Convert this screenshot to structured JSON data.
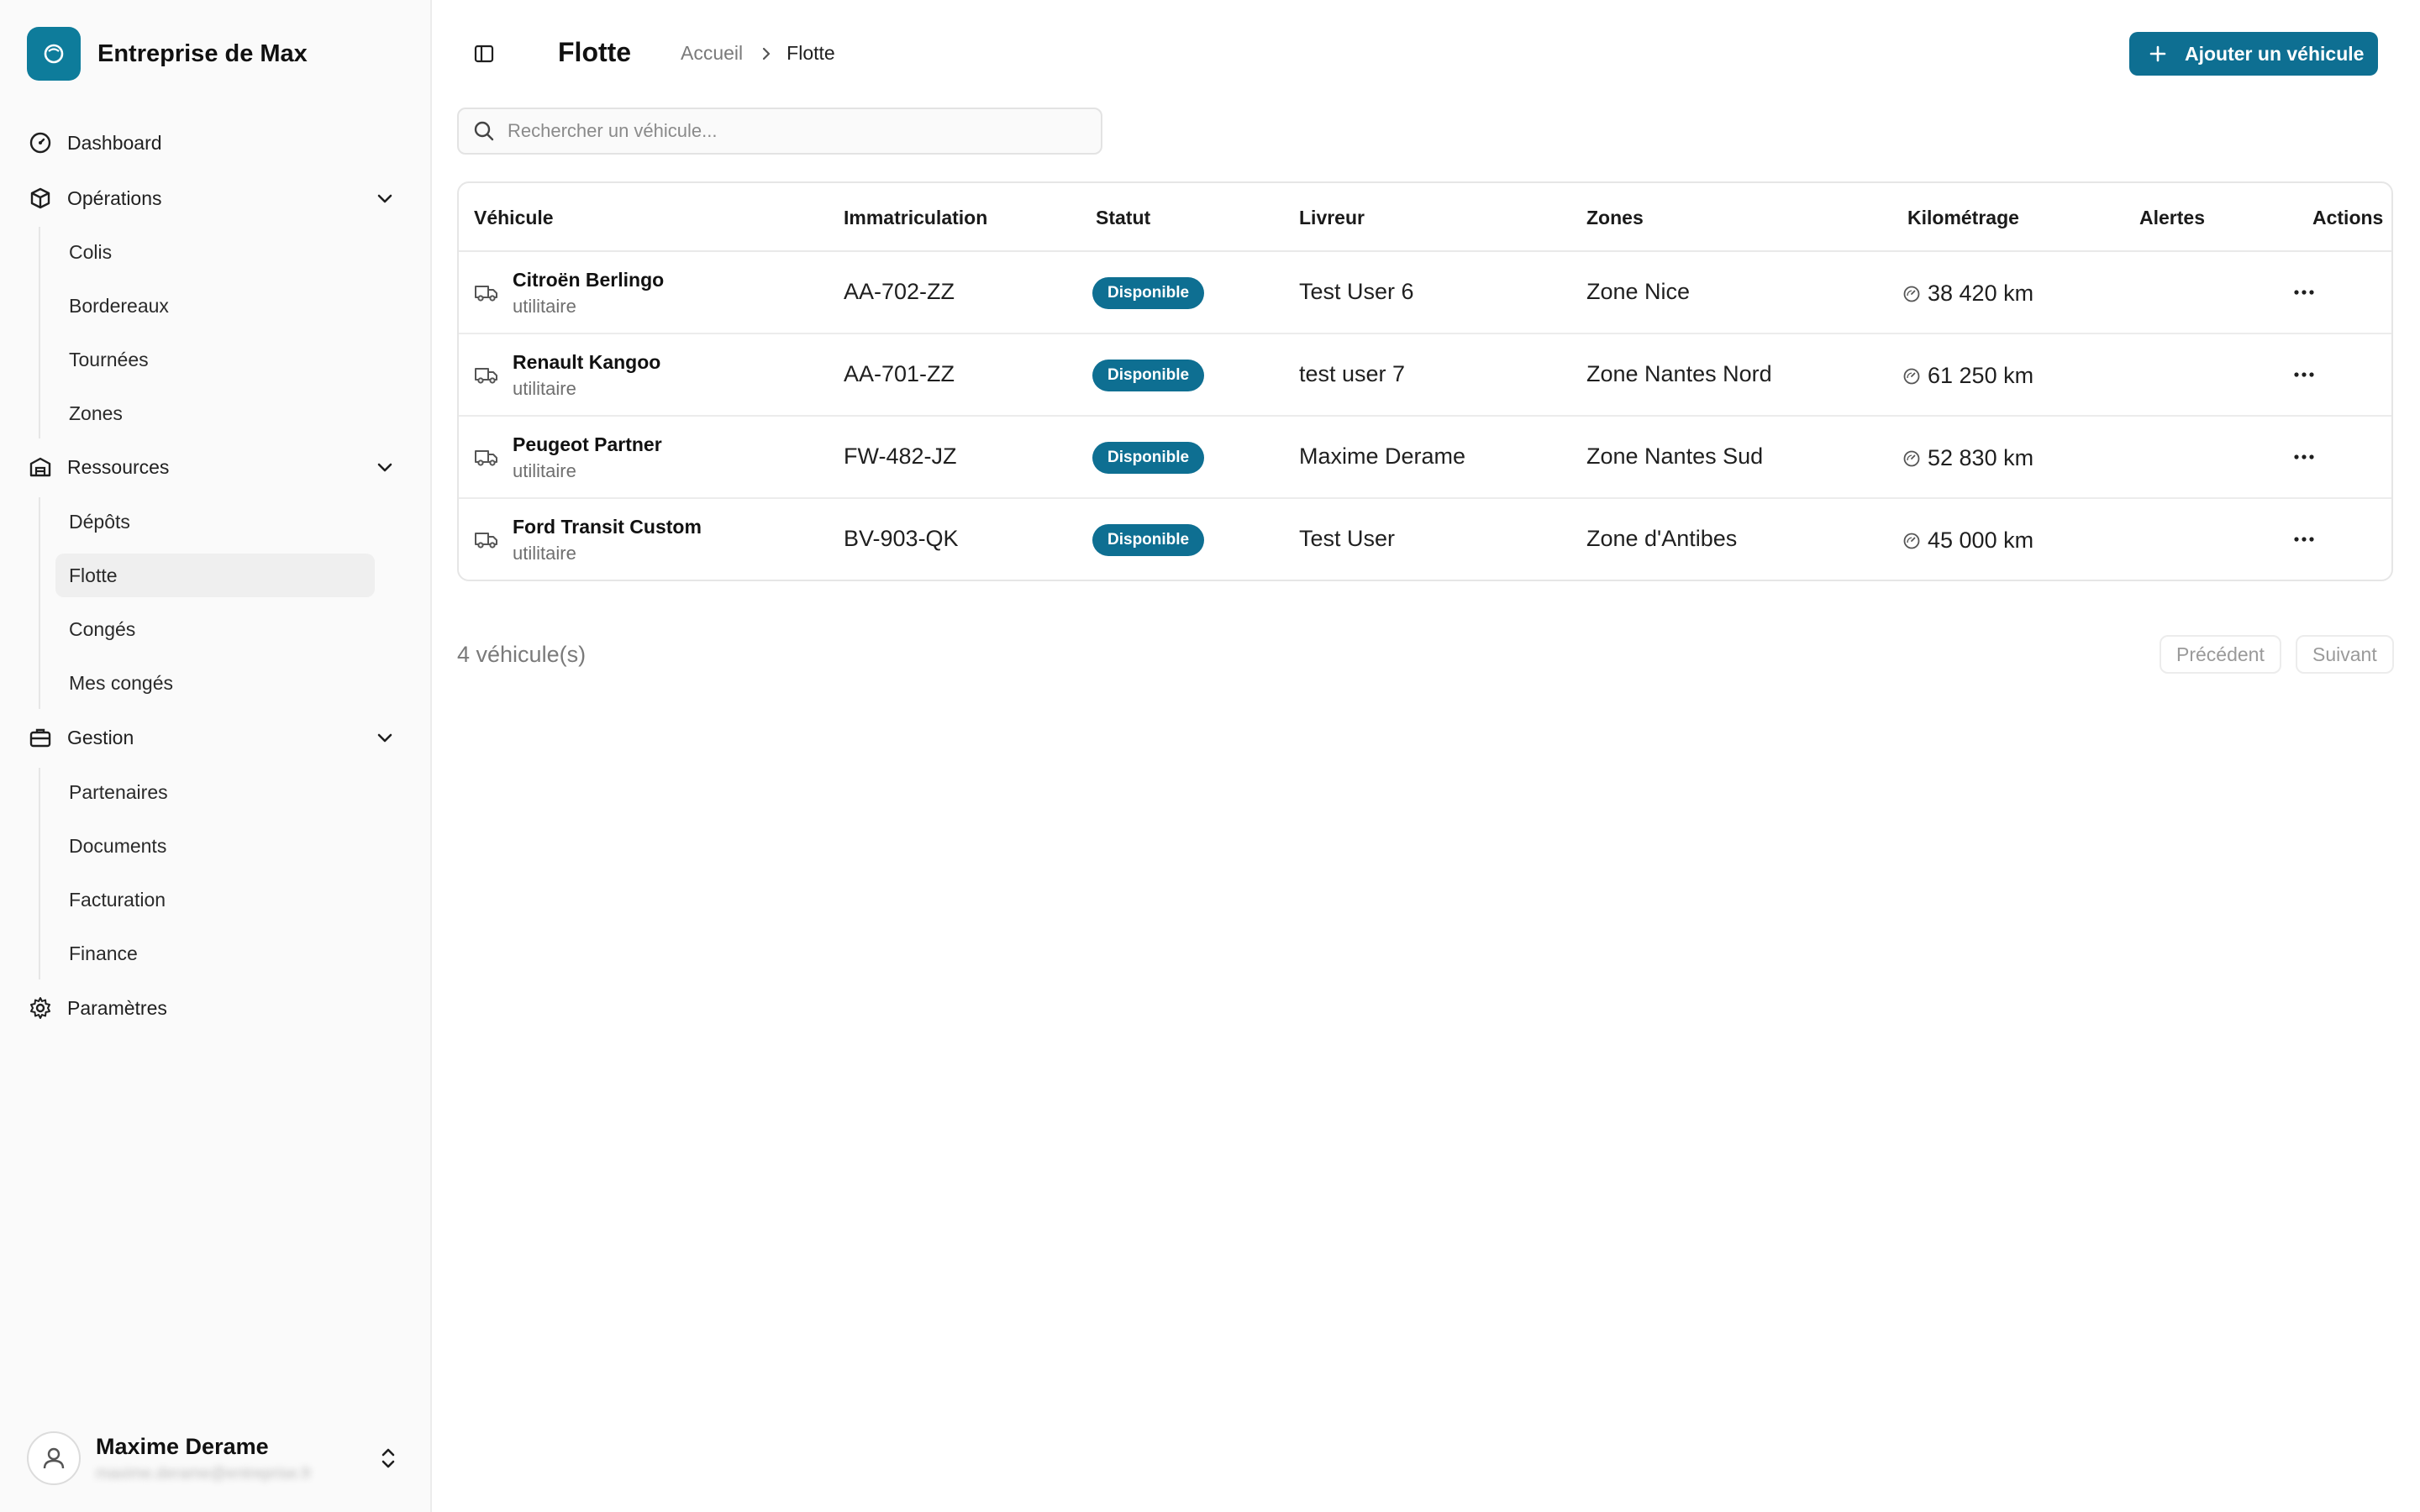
{
  "app": {
    "brand_name": "Entreprise de Max",
    "accent_color": "#0e6f92"
  },
  "sidebar": {
    "sections": [
      {
        "label": "Dashboard",
        "icon": "dashboard-icon"
      },
      {
        "label": "Opérations",
        "icon": "package-icon",
        "items": [
          "Colis",
          "Bordereaux",
          "Tournées",
          "Zones"
        ]
      },
      {
        "label": "Ressources",
        "icon": "building-icon",
        "items": [
          "Dépôts",
          "Flotte",
          "Congés",
          "Mes congés"
        ]
      },
      {
        "label": "Gestion",
        "icon": "briefcase-icon",
        "items": [
          "Partenaires",
          "Documents",
          "Facturation",
          "Finance"
        ]
      },
      {
        "label": "Paramètres",
        "icon": "gear-icon"
      }
    ],
    "active_item": "Flotte",
    "user": {
      "name": "Maxime Derame",
      "email": "maxime.derame@entreprise.fr"
    }
  },
  "header": {
    "title": "Flotte",
    "breadcrumb": [
      "Accueil",
      "Flotte"
    ],
    "add_button_label": "Ajouter un véhicule"
  },
  "search": {
    "placeholder": "Rechercher un véhicule..."
  },
  "table": {
    "columns": [
      "Véhicule",
      "Immatriculation",
      "Statut",
      "Livreur",
      "Zones",
      "Kilométrage",
      "Alertes",
      "Actions"
    ],
    "rows": [
      {
        "name": "Citroën Berlingo",
        "type": "utilitaire",
        "plate": "AA-702-ZZ",
        "status": "Disponible",
        "driver": "Test User 6",
        "zone": "Zone Nice",
        "km": "38 420 km",
        "alerts": ""
      },
      {
        "name": "Renault Kangoo",
        "type": "utilitaire",
        "plate": "AA-701-ZZ",
        "status": "Disponible",
        "driver": "test user 7",
        "zone": "Zone Nantes Nord",
        "km": "61 250 km",
        "alerts": ""
      },
      {
        "name": "Peugeot Partner",
        "type": "utilitaire",
        "plate": "FW-482-JZ",
        "status": "Disponible",
        "driver": "Maxime Derame",
        "zone": "Zone Nantes Sud",
        "km": "52 830 km",
        "alerts": ""
      },
      {
        "name": "Ford Transit Custom",
        "type": "utilitaire",
        "plate": "BV-903-QK",
        "status": "Disponible",
        "driver": "Test User",
        "zone": "Zone d'Antibes",
        "km": "45 000 km",
        "alerts": ""
      }
    ]
  },
  "footer": {
    "count": "4 véhicule(s)",
    "prev_label": "Précédent",
    "next_label": "Suivant"
  }
}
